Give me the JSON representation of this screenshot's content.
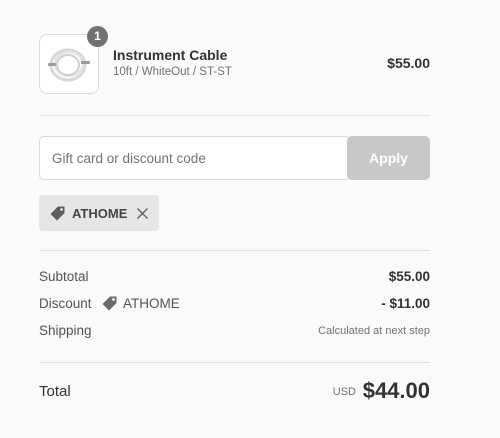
{
  "product": {
    "quantity": "1",
    "name": "Instrument Cable",
    "variant": "10ft / WhiteOut / ST-ST",
    "price": "$55.00"
  },
  "discount": {
    "placeholder": "Gift card or discount code",
    "value": "",
    "apply_label": "Apply",
    "applied_code": "ATHOME"
  },
  "totals": {
    "subtotal_label": "Subtotal",
    "subtotal_value": "$55.00",
    "discount_label": "Discount",
    "discount_code": "ATHOME",
    "discount_value": "- $11.00",
    "shipping_label": "Shipping",
    "shipping_value": "Calculated at next step"
  },
  "total": {
    "label": "Total",
    "currency": "USD",
    "amount": "$44.00"
  },
  "icons": {
    "tag": "tag-icon",
    "remove": "close-icon"
  },
  "colors": {
    "apply_button_disabled": "#c8c8c8",
    "tag_background": "#e6e6e6",
    "badge": "#727272"
  }
}
